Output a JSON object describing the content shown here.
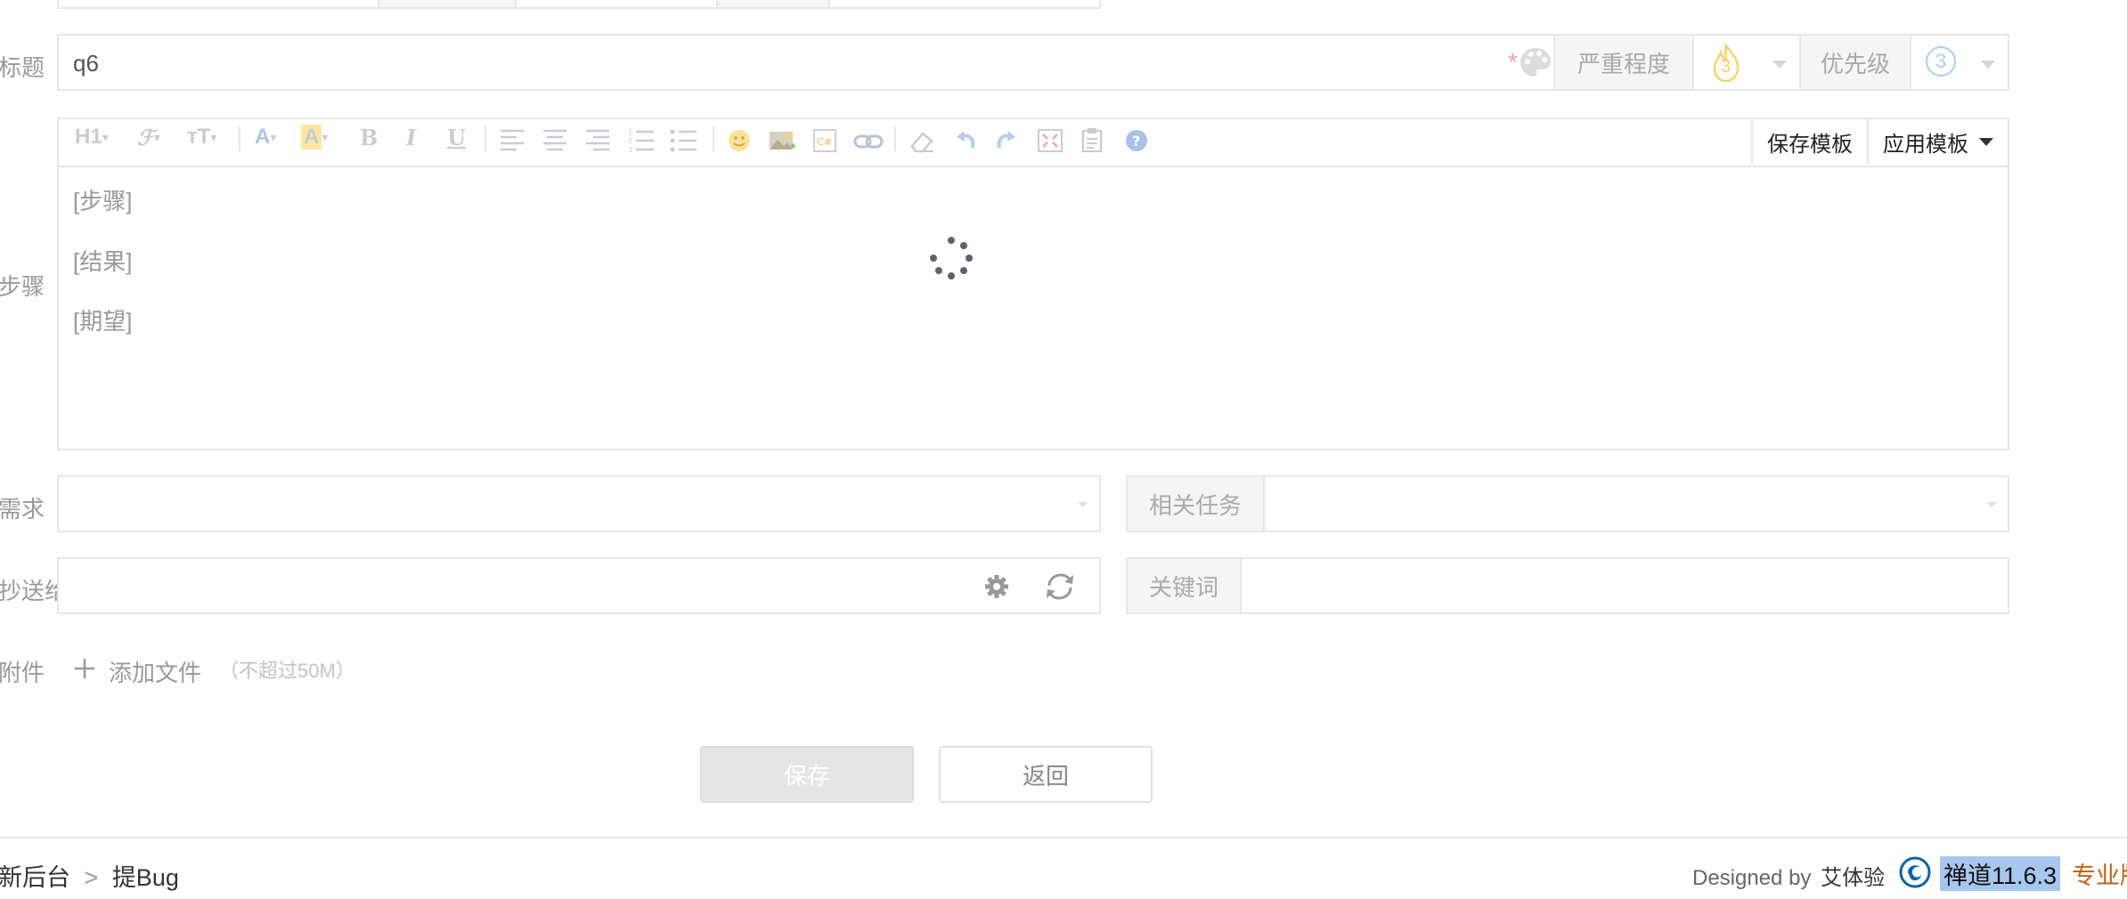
{
  "form": {
    "title_label": "标题",
    "title_value": "q6",
    "required_mark": "*",
    "severity_label": "严重程度",
    "severity_value": "3",
    "priority_label": "优先级",
    "priority_value": "3",
    "steps_label": "步骤",
    "editor_lines": [
      "[步骤]",
      "[结果]",
      "[期望]"
    ],
    "save_template": "保存模板",
    "apply_template": "应用模板",
    "toolbar": {
      "heading": "H1",
      "font_family": "ℱ",
      "font_size": "тT",
      "font_color": "A",
      "background_color": "A",
      "bold": "B",
      "italic": "I",
      "underline": "U"
    },
    "story_label": "需求",
    "task_label": "相关任务",
    "mailto_label": "抄送给",
    "keywords_label": "关键词",
    "files_label": "附件",
    "add_file": "添加文件",
    "file_limit": "（不超过50M）",
    "save_button": "保存",
    "back_button": "返回"
  },
  "footer": {
    "breadcrumb_parent": "新后台",
    "breadcrumb_sep": ">",
    "breadcrumb_current": "提Bug",
    "designed_by": "Designed by",
    "designer": "艾体验",
    "version": "禅道11.6.3",
    "edition": "专业版"
  },
  "colors": {
    "accent": "#0c64a8",
    "severity": "#f8d36b",
    "priority": "#a9cdf5",
    "required": "#f0a3a3",
    "edition": "#c0641c",
    "version_highlight": "#a7c7ef"
  }
}
